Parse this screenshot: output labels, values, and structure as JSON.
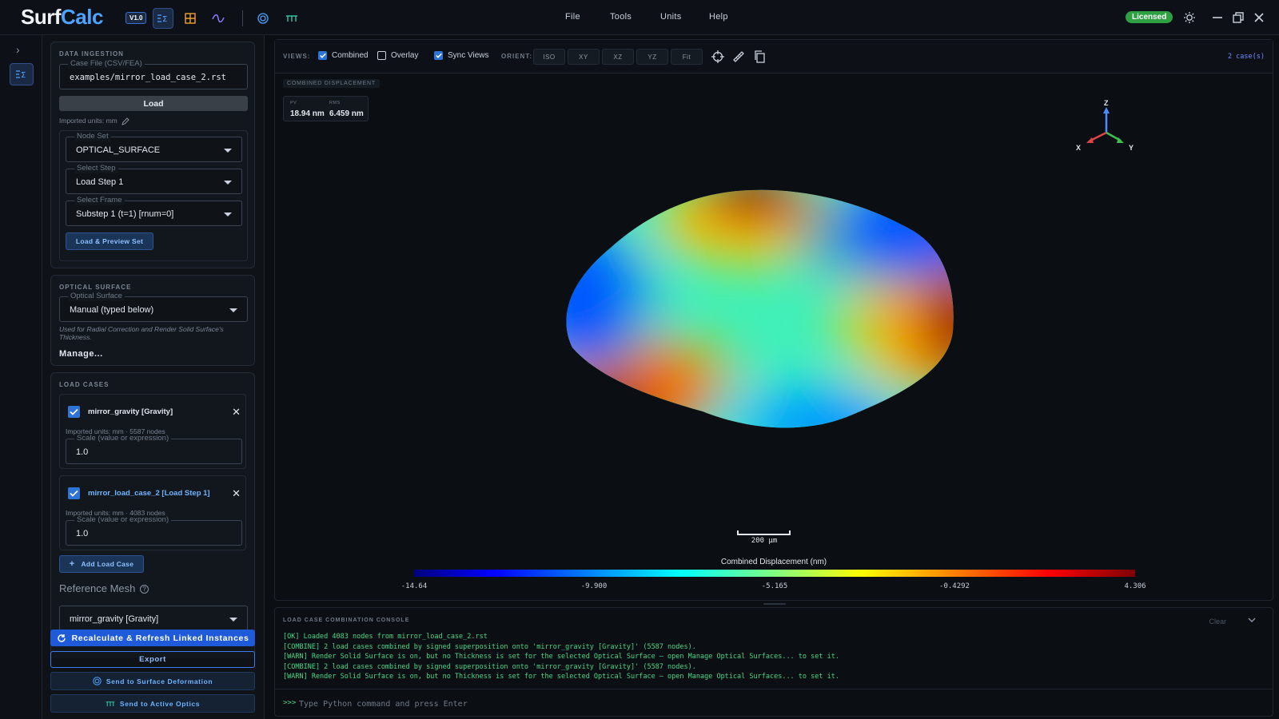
{
  "app": {
    "brand_surf": "Surf",
    "brand_calc": "Calc",
    "version": "V1.0",
    "brand_colors": {
      "surf": "#f2f5f8",
      "calc": "#4da3ff"
    }
  },
  "menu": {
    "file": "File",
    "tools": "Tools",
    "units": "Units",
    "help": "Help"
  },
  "status": {
    "license": "Licensed"
  },
  "data_ingestion": {
    "title": "DATA INGESTION",
    "case_file_label": "Case File (CSV/FEA)",
    "case_file_value": "examples/mirror_load_case_2.rst",
    "load_label": "Load",
    "imported_units": "Imported units: mm",
    "node_set_label": "Node Set",
    "node_set_value": "OPTICAL_SURFACE",
    "step_label": "Select Step",
    "step_value": "Load Step 1",
    "frame_label": "Select Frame",
    "frame_value": "Substep 1 (t=1) [rnum=0]",
    "preview_label": "Load & Preview Set"
  },
  "optical_surface": {
    "title": "OPTICAL SURFACE",
    "field_label": "Optical Surface",
    "field_value": "Manual (typed below)",
    "note": "Used for Radial Correction and Render Solid Surface's Thickness.",
    "manage_label": "Manage..."
  },
  "load_cases": {
    "title": "LOAD CASES",
    "items": [
      {
        "name": "mirror_gravity [Gravity]",
        "meta": "Imported units: mm · 5587 nodes",
        "scale_label": "Scale (value or expression)",
        "scale_value": "1.0"
      },
      {
        "name": "mirror_load_case_2 [Load Step 1]",
        "meta": "Imported units: mm · 4083 nodes",
        "scale_label": "Scale (value or expression)",
        "scale_value": "1.0"
      }
    ],
    "add_label": "Add Load Case",
    "reference_label": "Reference Mesh",
    "reference_value": "mirror_gravity [Gravity]"
  },
  "actions": {
    "recalculate": "Recalculate & Refresh Linked Instances",
    "export": "Export",
    "send_deformation": "Send to Surface Deformation",
    "send_optics": "Send to Active Optics"
  },
  "viewer": {
    "views_label": "VIEWS:",
    "combined_label": "Combined",
    "overlay_label": "Overlay",
    "sync_label": "Sync Views",
    "orient_label": "ORIENT:",
    "orient_buttons": [
      "ISO",
      "XY",
      "XZ",
      "YZ",
      "Fit"
    ],
    "case_count": "2 case(s)",
    "view_tag": "COMBINED DISPLACEMENT",
    "pv_label": "PV",
    "pv_value": "18.94 nm",
    "rms_label": "RMS",
    "rms_value": "6.459 nm",
    "triad": {
      "z": "Z",
      "x": "X",
      "y": "Y"
    },
    "scale_bar": "200 µm",
    "colorbar": {
      "title": "Combined Displacement (nm)",
      "min": -14.64,
      "max": 4.306,
      "ticks": [
        "-14.64",
        "-9.900",
        "-5.165",
        "-0.4292",
        "4.306"
      ]
    }
  },
  "console": {
    "title": "LOAD CASE COMBINATION CONSOLE",
    "clear_label": "Clear",
    "lines": [
      "[OK] Loaded 4083 nodes from mirror_load_case_2.rst",
      "[COMBINE] 2 load cases combined by signed superposition onto 'mirror_gravity [Gravity]' (5587 nodes).",
      "[WARN] Render Solid Surface is on, but no Thickness is set for the selected Optical Surface — open Manage Optical Surfaces... to set it.",
      "[COMBINE] 2 load cases combined by signed superposition onto 'mirror_gravity [Gravity]' (5587 nodes).",
      "[WARN] Render Solid Surface is on, but no Thickness is set for the selected Optical Surface — open Manage Optical Surfaces... to set it."
    ],
    "prompt": ">>>",
    "placeholder": "Type Python command and press Enter"
  }
}
